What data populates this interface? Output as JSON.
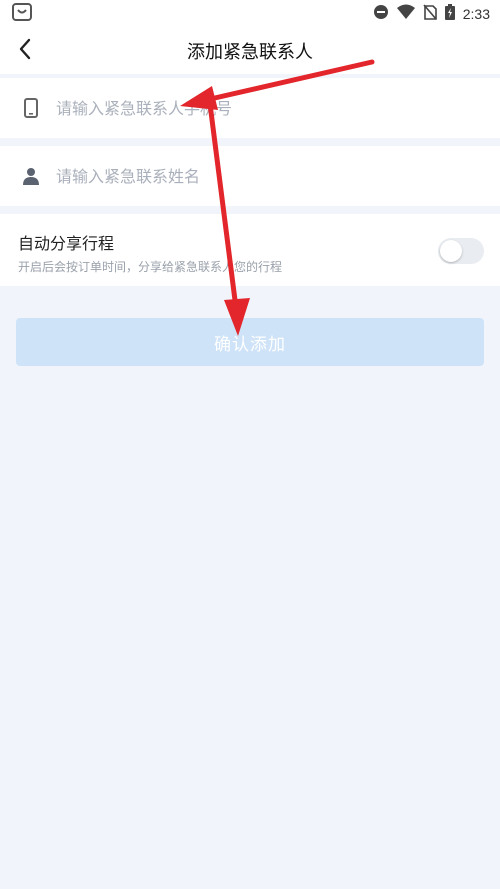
{
  "status_bar": {
    "time": "2:33"
  },
  "header": {
    "title": "添加紧急联系人"
  },
  "form": {
    "phone_placeholder": "请输入紧急联系人手机号",
    "name_placeholder": "请输入紧急联系姓名"
  },
  "auto_share": {
    "title": "自动分享行程",
    "description": "开启后会按订单时间，分享给紧急联系人您的行程",
    "enabled": false
  },
  "confirm_button": {
    "label": "确认添加"
  },
  "colors": {
    "page_background": "#f1f4fb",
    "button_disabled": "#cfe3f8",
    "annotation_arrow": "#e3262b"
  },
  "icons": [
    "app-notification-icon",
    "do-not-disturb-icon",
    "wifi-icon",
    "no-sim-icon",
    "battery-charging-icon",
    "back-arrow-icon",
    "phone-icon",
    "person-icon"
  ]
}
